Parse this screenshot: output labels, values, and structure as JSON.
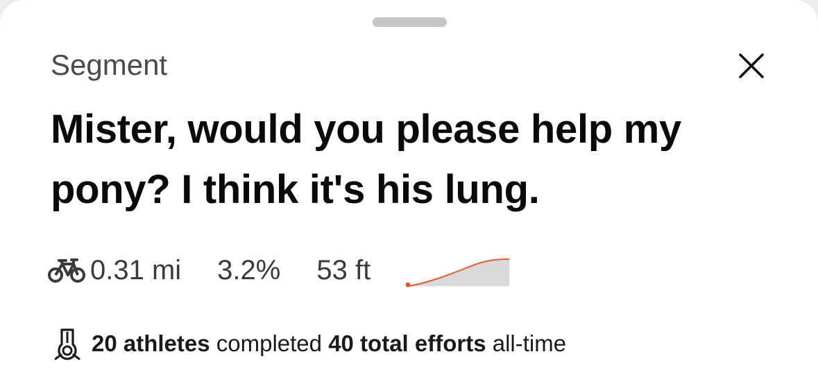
{
  "sheet": {
    "eyebrow": "Segment",
    "title": "Mister, would you please help my pony? I think it's his lung."
  },
  "stats": {
    "sport_icon": "bike-icon",
    "distance": "0.31 mi",
    "grade": "3.2%",
    "elevation": "53 ft",
    "profile_colors": {
      "line": "#e4572e",
      "fill": "#d9d9d9"
    }
  },
  "completion": {
    "icon": "medal-icon",
    "athletes": "20 athletes",
    "middle": " completed ",
    "efforts": "40 total efforts",
    "suffix": " all-time"
  },
  "actions": {
    "close_icon": "close-icon"
  }
}
